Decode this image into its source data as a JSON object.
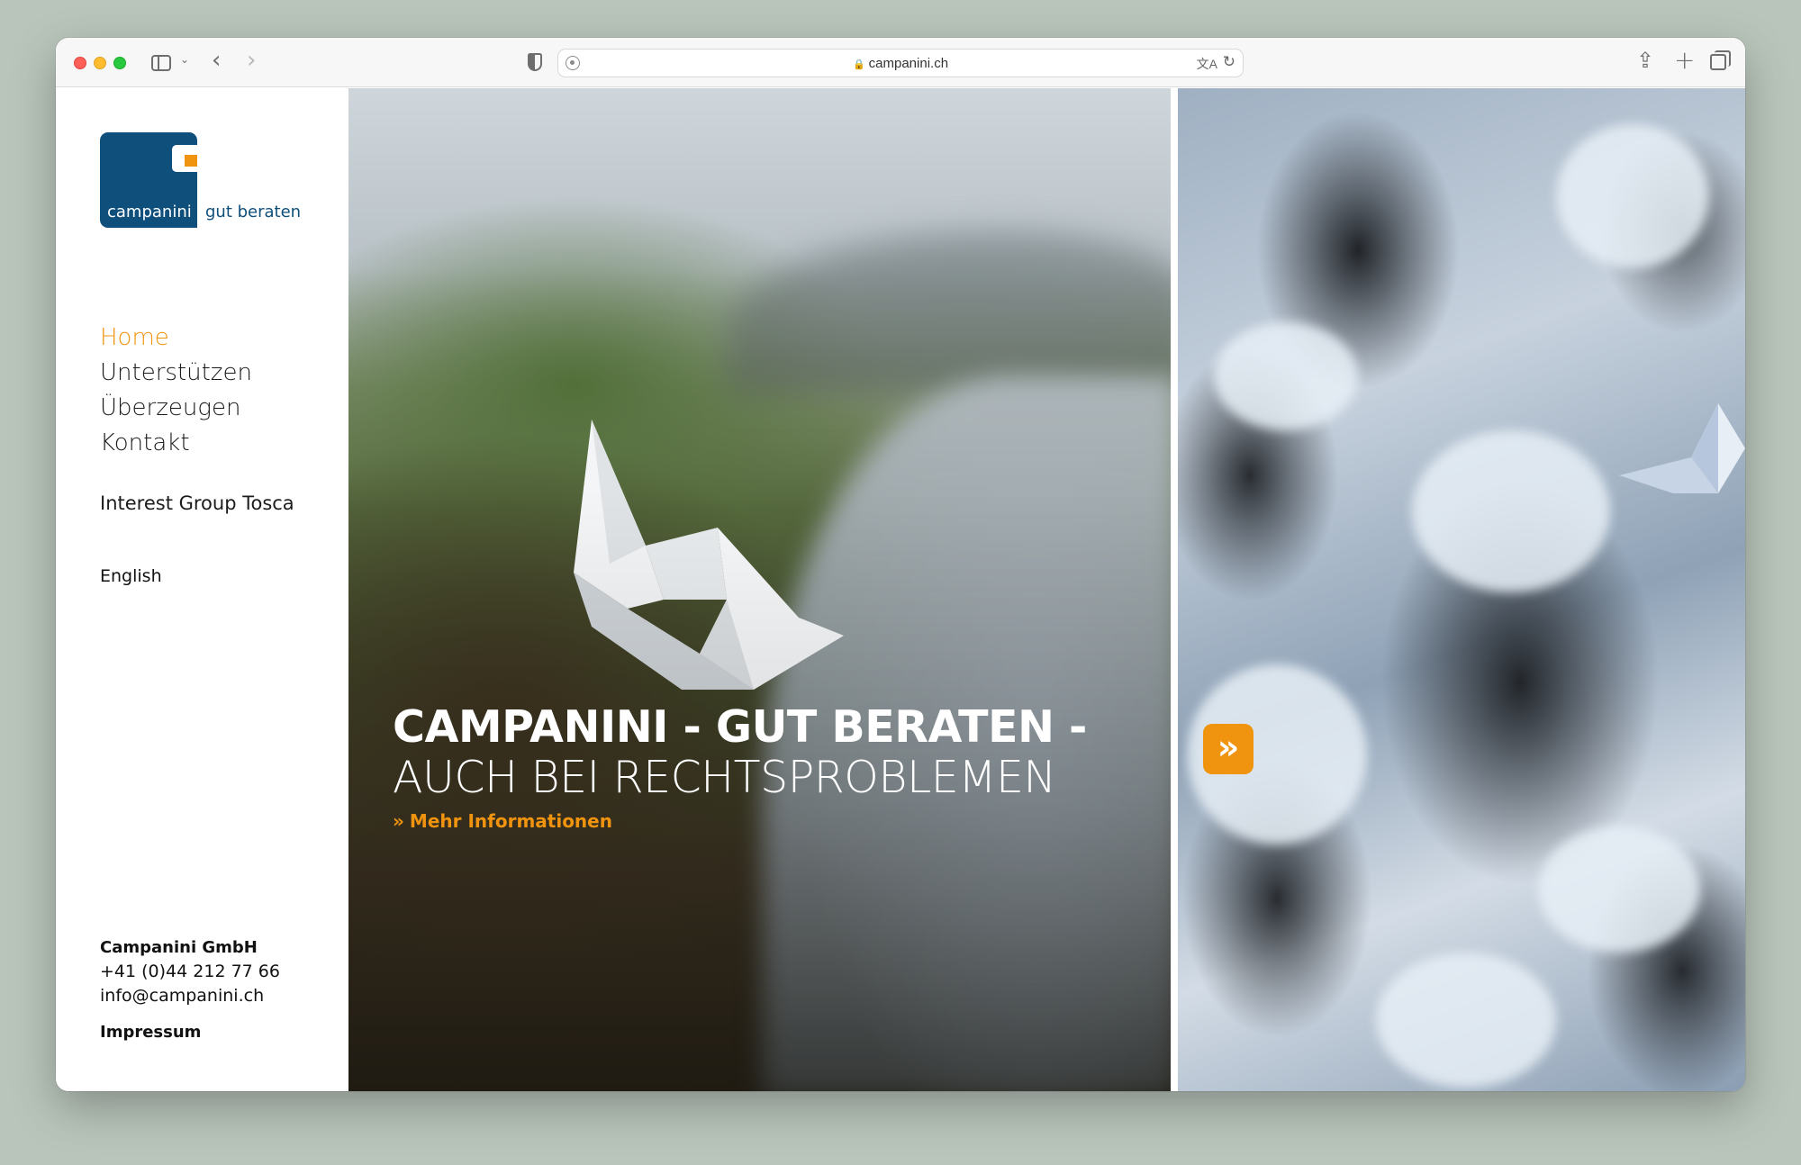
{
  "browser": {
    "url": "campanini.ch",
    "icons": [
      "sidebar-icon",
      "chevron-down-icon",
      "back-icon",
      "forward-icon",
      "privacy-shield-icon",
      "site-settings-icon",
      "lock-icon",
      "translate-icon",
      "reload-icon",
      "share-icon",
      "new-tab-icon",
      "tab-overview-icon"
    ]
  },
  "logo": {
    "word": "campanini",
    "tagline": "gut beraten"
  },
  "nav": {
    "items": [
      {
        "label": "Home",
        "active": true
      },
      {
        "label": "Unterstützen",
        "active": false
      },
      {
        "label": "Überzeugen",
        "active": false
      },
      {
        "label": "Kontakt",
        "active": false
      }
    ],
    "extra": "Interest Group Tosca",
    "language": "English"
  },
  "footer": {
    "company": "Campanini GmbH",
    "phone": "+41 (0)44 212 77 66",
    "email": "info@campanini.ch",
    "impressum": "Impressum"
  },
  "hero": {
    "headline_bold": "CAMPANINI - GUT BERATEN -",
    "headline_light": "AUCH BEI RECHTSPROBLEMEN",
    "link_label": "Mehr Informationen",
    "link_chevron": "»"
  },
  "slider": {
    "next_label": "»"
  },
  "colors": {
    "accent": "#f0940f",
    "brand_blue": "#0f4f7b",
    "text": "#1c1c1c"
  }
}
